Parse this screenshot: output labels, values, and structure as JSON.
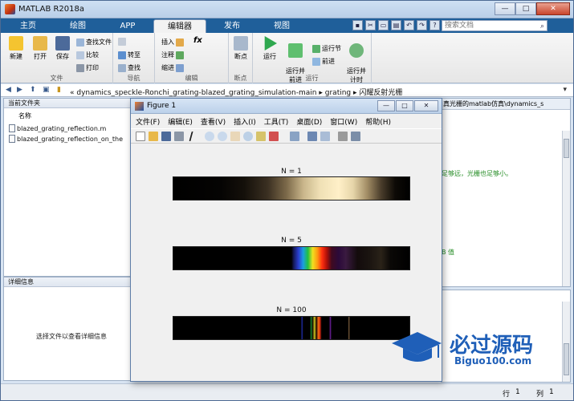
{
  "window": {
    "title": "MATLAB R2018a"
  },
  "tabs": [
    {
      "label": "主页"
    },
    {
      "label": "绘图"
    },
    {
      "label": "APP"
    },
    {
      "label": "编辑器"
    },
    {
      "label": "发布"
    },
    {
      "label": "视图"
    }
  ],
  "search": {
    "placeholder": "搜索文档"
  },
  "toolstrip": {
    "file": {
      "label": "文件",
      "new": "新建",
      "open": "打开",
      "save": "保存",
      "find_files": "查找文件",
      "compare": "比较",
      "print": "打印"
    },
    "navigate": {
      "label": "导航",
      "goto": "转至",
      "find": "查找"
    },
    "edit": {
      "label": "编辑",
      "insert": "插入",
      "comment": "注释",
      "indent": "缩进",
      "fx": "fx"
    },
    "breakpoints": {
      "label": "断点",
      "breakpoints": "断点"
    },
    "run": {
      "label": "运行",
      "run": "运行",
      "run_advance": "运行并\n前进",
      "run_section": "运行节",
      "advance": "前进",
      "run_time": "运行并\n计时"
    }
  },
  "address": {
    "prefix": "«",
    "segments": [
      "dynamics_speckle-Ronchi_grating-blazed_grating_simulation-main",
      "grating",
      "闪耀反射光栅"
    ]
  },
  "current_folder": {
    "title": "当前文件夹",
    "column": "名称",
    "files": [
      "blazed_grating_reflection.m",
      "blazed_grating_reflection_on_the"
    ]
  },
  "details": {
    "title": "详细信息",
    "hint": "选择文件以查看详细信息"
  },
  "editor": {
    "tab_text": "真光栅的matlab仿真\\dynamics_s",
    "lines": [
      "足够远，光栅也足够小。",
      "B 值"
    ]
  },
  "status": {
    "row_label": "行",
    "row": "1",
    "col_label": "列",
    "col": "1"
  },
  "figure": {
    "title": "Figure 1",
    "menu": [
      "文件(F)",
      "编辑(E)",
      "查看(V)",
      "插入(I)",
      "工具(T)",
      "桌面(D)",
      "窗口(W)",
      "帮助(H)"
    ],
    "plots": [
      {
        "title": "N = 1"
      },
      {
        "title": "N = 5"
      },
      {
        "title": "N = 100"
      }
    ]
  },
  "watermark": {
    "text": "必过源码",
    "url": "Biguo100.com"
  },
  "colors": {
    "accent": "#1f5f9a",
    "watermark": "#1f5fb8"
  }
}
